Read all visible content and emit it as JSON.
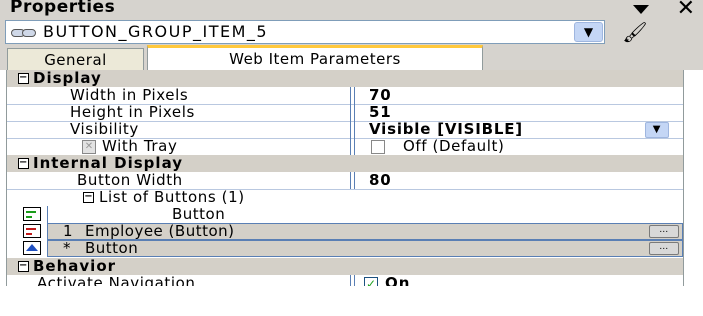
{
  "panel_title": "Properties",
  "object_combo": {
    "value": "BUTTON_GROUP_ITEM_5"
  },
  "tabs": [
    {
      "label": "General",
      "active": false
    },
    {
      "label": "Web Item Parameters",
      "active": true
    }
  ],
  "sections": {
    "display": {
      "title": "Display",
      "rows": {
        "width": {
          "label": "Width in Pixels",
          "value": "70"
        },
        "height": {
          "label": "Height in Pixels",
          "value": "51"
        },
        "visibility": {
          "label": "Visibility",
          "value": "Visible [VISIBLE]"
        },
        "with_tray": {
          "label": "With Tray",
          "value": "Off (Default)"
        }
      }
    },
    "internal_display": {
      "title": "Internal Display",
      "button_width": {
        "label": "Button Width",
        "value": "80"
      },
      "list_title": "List of Buttons (1)",
      "list_items": [
        {
          "index": "",
          "text": "Button"
        },
        {
          "index": "1",
          "text": "Employee (Button)"
        },
        {
          "index": "*",
          "text": "Button"
        }
      ]
    },
    "behavior": {
      "title": "Behavior",
      "activate_navigation": {
        "label": "Activate Navigation",
        "value": "On"
      }
    }
  },
  "colors": {
    "accent_tab": "#ffc83c",
    "row_selected": "#d4d0c8",
    "list_icon_green": "#1a9c1a",
    "list_icon_red": "#c01818",
    "list_icon_blue": "#2050c0"
  }
}
